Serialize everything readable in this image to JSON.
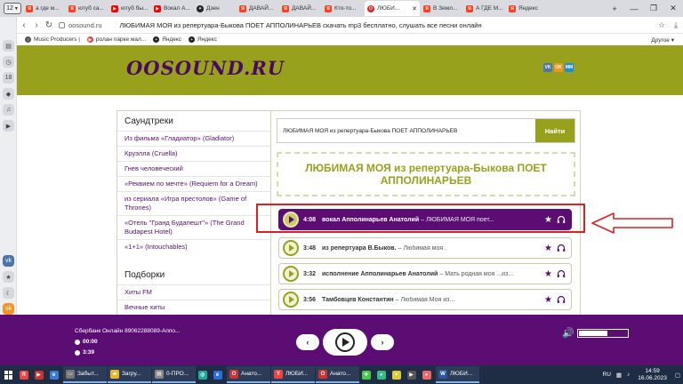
{
  "browser": {
    "tab_count": "12",
    "tabs": [
      {
        "icon": "yandex-icon",
        "label": "а где м..."
      },
      {
        "icon": "yandex-icon",
        "label": "ютуб са..."
      },
      {
        "icon": "youtube-icon",
        "label": "ютуб бы..."
      },
      {
        "icon": "youtube-icon",
        "label": "Вокал А..."
      },
      {
        "icon": "dzen-icon",
        "label": "Дзен"
      },
      {
        "icon": "yandex-icon",
        "label": "ДАВАЙ..."
      },
      {
        "icon": "yandex-icon",
        "label": "ДАВАЙ..."
      },
      {
        "icon": "yandex-icon",
        "label": "Кто-то..."
      },
      {
        "icon": "oosound-icon",
        "label": "ЛЮБИ...",
        "active": true
      },
      {
        "icon": "yandex-icon",
        "label": "В Земл..."
      },
      {
        "icon": "yandex-icon",
        "label": "А ГДЕ М..."
      },
      {
        "icon": "yandex-icon",
        "label": "Яндекс"
      }
    ],
    "url": "oosound.ru",
    "page_title": "ЛЮБИМАЯ МОЯ из репертуара-Быкова ПОЕТ АППОЛИНАРЬЕВ скачать mp3 бесплатно, слушать все песни онлайн",
    "bookmarks": [
      {
        "label": "Music Producers |"
      },
      {
        "label": "ролан парке мал..."
      },
      {
        "label": "Яндекс"
      },
      {
        "label": "Яндекс"
      }
    ],
    "bookmarks_other": "Другое"
  },
  "site": {
    "logo": "OOSOUND.RU",
    "social": [
      "VK",
      "OK",
      "MM"
    ],
    "sidebar": {
      "heading1": "Саундтреки",
      "links1": [
        "Из фильма «Гладиатор» (Gladiator)",
        "Круэлла (Cruella)",
        "Гнев человеческий",
        "«Реквием по мечте» (Requiem for a Dream)",
        "из сериала «Игра престолов» (Game of Thrones)",
        "«Отель \"Гранд Будапешт\"» (The Grand Budapest Hotel)",
        "«1+1» (Intouchables)"
      ],
      "heading2": "Подборки",
      "links2": [
        "Хиты FM",
        "Вечные хиты"
      ]
    },
    "search": {
      "value": "ЛЮБИМАЯ МОЯ из репертуара-Быкова ПОЕТ АППОЛИНАРЬЕВ",
      "button": "Найти"
    },
    "page_heading": "ЛЮБИМАЯ МОЯ из репертуара-Быкова ПОЕТ АППОЛИНАРЬЕВ",
    "tracks": [
      {
        "duration": "4:08",
        "artist": "вокал Апполинарьев Анатолий",
        "sep": "–",
        "song": "ЛЮБИМАЯ МОЯ поет...",
        "active": true
      },
      {
        "duration": "3:48",
        "artist": "из репертуара В.Быков.",
        "sep": "–",
        "song": "Любимая моя ."
      },
      {
        "duration": "3:32",
        "artist": "исполнение Апполинарьев Анатолий",
        "sep": "–",
        "song": "Мать родная моя ...из..."
      },
      {
        "duration": "3:56",
        "artist": "Тамбовцев Константин",
        "sep": "–",
        "song": "Любимая Моя из..."
      }
    ]
  },
  "player": {
    "title": "Сбербанк Онлайн 89062288089-Аппо...",
    "elapsed": "00:00",
    "total": "3:39",
    "prev": "‹",
    "next": "›",
    "volume_level": 0.62
  },
  "taskbar": {
    "items": [
      {
        "label": "Забыт...",
        "running": true
      },
      {
        "label": "Загру...",
        "running": true
      },
      {
        "label": "0-ПРО...",
        "running": true
      },
      {
        "label": "Анато...",
        "running": true
      },
      {
        "label": "ЛЮБИ...",
        "running": true
      },
      {
        "label": "Анато...",
        "running": true
      },
      {
        "label": "ЛЮБИ...",
        "running": true
      }
    ],
    "lang": "RU",
    "time": "14:59",
    "date": "16.06.2023"
  },
  "colors": {
    "brand_olive": "#98a11c",
    "brand_purple": "#5b0d74",
    "highlight_red": "#e02020"
  }
}
